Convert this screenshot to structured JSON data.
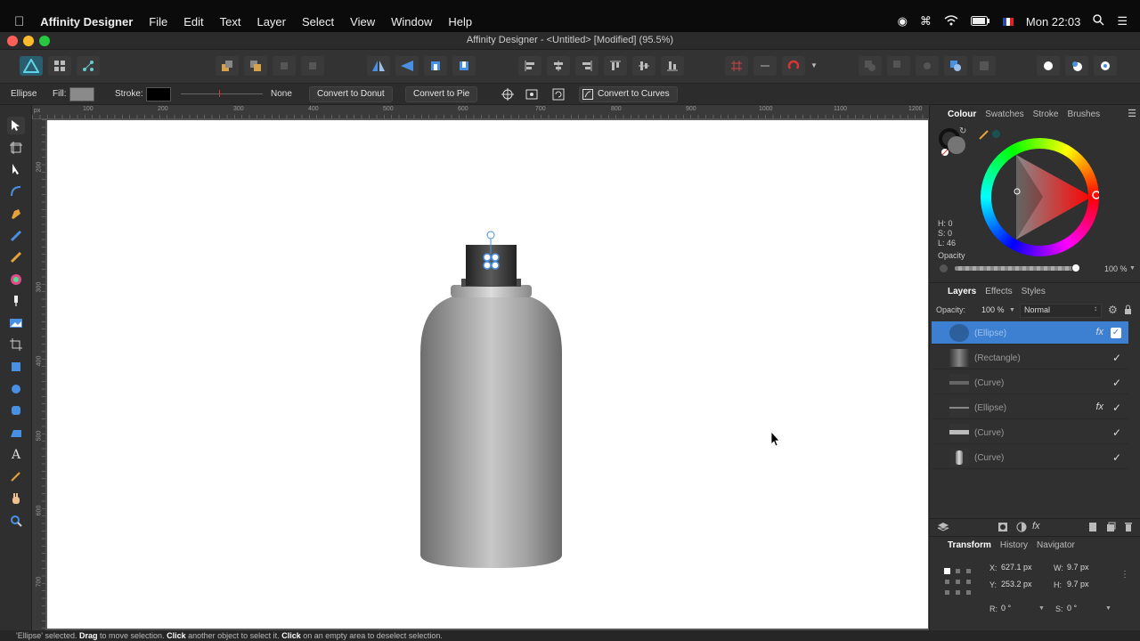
{
  "menubar": {
    "app": "Affinity Designer",
    "items": [
      "File",
      "Edit",
      "Text",
      "Layer",
      "Select",
      "View",
      "Window",
      "Help"
    ],
    "clock": "Mon 22:03"
  },
  "window": {
    "title": "Affinity Designer - <Untitled> [Modified] (95.5%)"
  },
  "context": {
    "shape": "Ellipse",
    "fill_label": "Fill:",
    "stroke_label": "Stroke:",
    "stroke_value": "None",
    "donut": "Convert to Donut",
    "pie": "Convert to Pie",
    "curves": "Convert to Curves",
    "fill_color": "#8a8a8a",
    "stroke_color": "#000000"
  },
  "ruler": {
    "h": [
      "100",
      "200",
      "300",
      "400",
      "500",
      "600",
      "700",
      "800",
      "900",
      "1000",
      "1100",
      "1200"
    ],
    "v": [
      "200",
      "300",
      "400",
      "500",
      "600",
      "700"
    ],
    "unit": "px"
  },
  "colour_panel": {
    "tabs": [
      "Colour",
      "Swatches",
      "Stroke",
      "Brushes"
    ],
    "h": "H: 0",
    "s": "S: 0",
    "l": "L: 46",
    "opacity_label": "Opacity",
    "opacity_value": "100 %"
  },
  "layers_panel": {
    "tabs": [
      "Layers",
      "Effects",
      "Styles"
    ],
    "opacity_label": "Opacity:",
    "opacity_value": "100 %",
    "blend": "Normal",
    "layers": [
      {
        "name": "(Ellipse)",
        "fx": "fx",
        "selected": true
      },
      {
        "name": "(Rectangle)",
        "fx": "",
        "selected": false
      },
      {
        "name": "(Curve)",
        "fx": "",
        "selected": false
      },
      {
        "name": "(Ellipse)",
        "fx": "fx",
        "selected": false
      },
      {
        "name": "(Curve)",
        "fx": "",
        "selected": false
      },
      {
        "name": "(Curve)",
        "fx": "",
        "selected": false
      }
    ]
  },
  "transform_panel": {
    "tabs": [
      "Transform",
      "History",
      "Navigator"
    ],
    "x_label": "X:",
    "x": "627.1 px",
    "y_label": "Y:",
    "y": "253.2 px",
    "w_label": "W:",
    "w": "9.7 px",
    "h_label": "H:",
    "h": "9.7 px",
    "r_label": "R:",
    "r": "0 °",
    "s_label": "S:",
    "s": "0 °"
  },
  "status": {
    "text_1": "'Ellipse' selected.",
    "drag": "Drag",
    "text_2": "to move selection.",
    "click": "Click",
    "text_3": "another object to select it.",
    "click2": "Click",
    "text_4": "on an empty area to deselect selection."
  },
  "colors": {
    "accent": "#4a90e2",
    "selection": "#3d7fd1"
  }
}
